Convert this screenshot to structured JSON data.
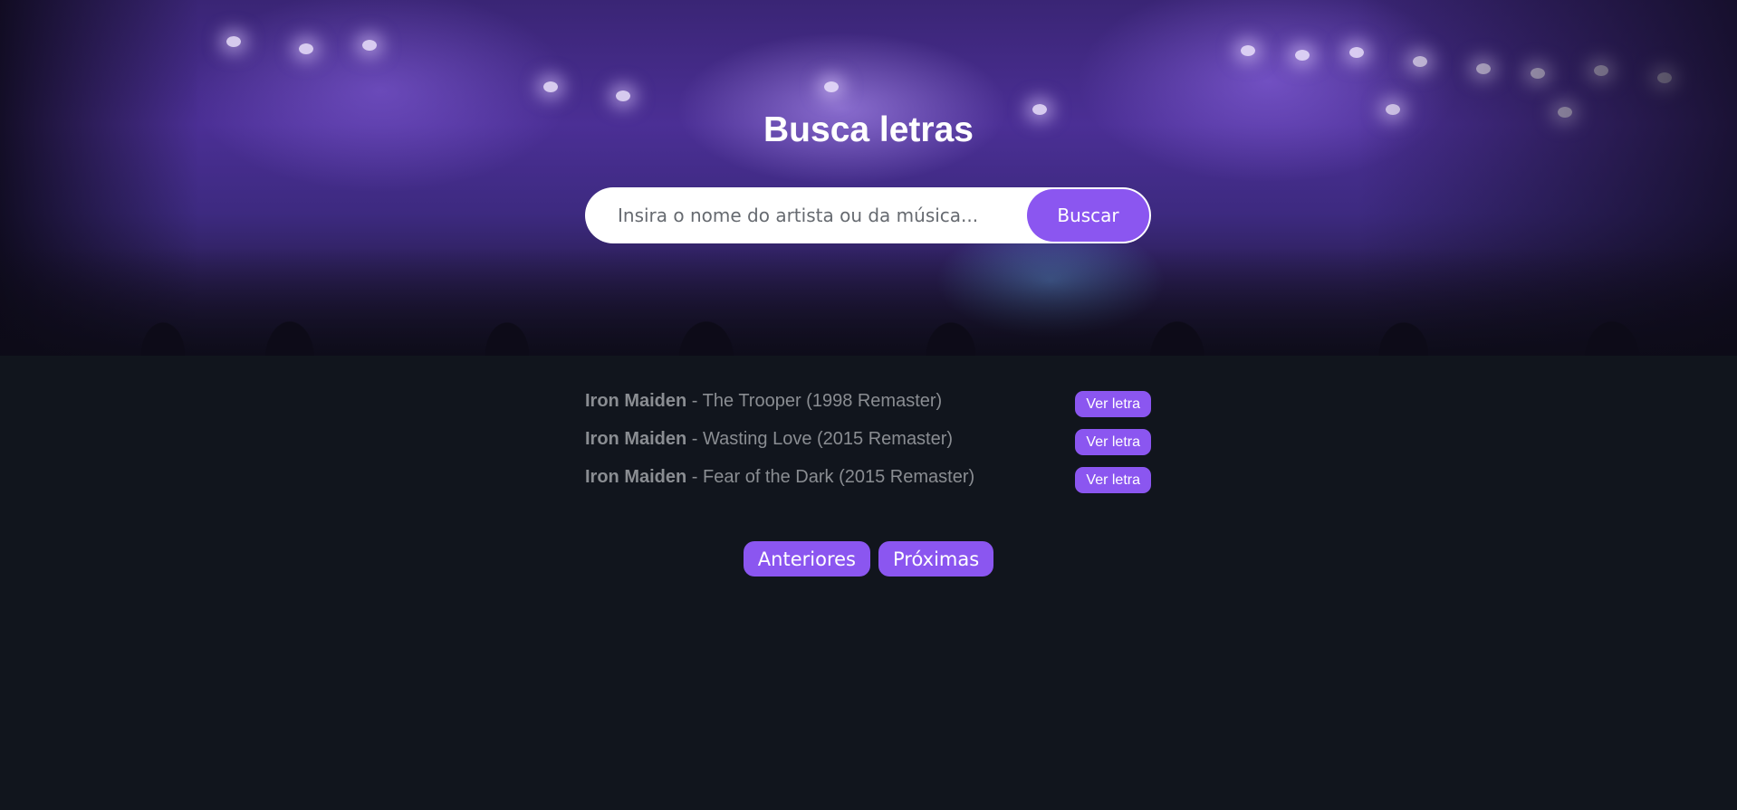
{
  "header": {
    "title": "Busca letras",
    "search": {
      "placeholder": "Insira o nome do artista ou da música...",
      "value": "",
      "button_label": "Buscar"
    }
  },
  "results": [
    {
      "artist": "Iron Maiden",
      "separator": " - ",
      "song": "The Trooper (1998 Remaster)",
      "button_label": "Ver letra"
    },
    {
      "artist": "Iron Maiden",
      "separator": " - ",
      "song": "Wasting Love (2015 Remaster)",
      "button_label": "Ver letra"
    },
    {
      "artist": "Iron Maiden",
      "separator": " - ",
      "song": "Fear of the Dark (2015 Remaster)",
      "button_label": "Ver letra"
    }
  ],
  "pagination": {
    "prev_label": "Anteriores",
    "next_label": "Próximas"
  },
  "colors": {
    "accent": "#8b56f0",
    "background": "#11151d",
    "text_muted": "#8a8d92",
    "title": "#ffffff"
  }
}
